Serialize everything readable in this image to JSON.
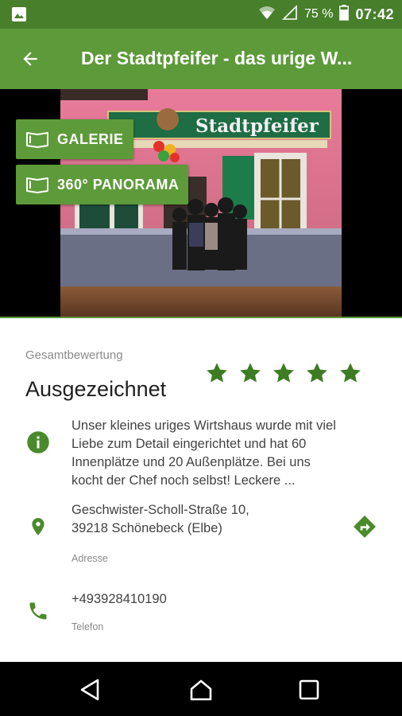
{
  "status_bar": {
    "battery_text": "75 %",
    "time": "07:42",
    "icons": [
      "image-icon",
      "wifi-icon",
      "signal-icon",
      "battery-icon"
    ]
  },
  "app_bar": {
    "title": "Der Stadtpfeifer - das urige W..."
  },
  "hero": {
    "sign_text": "Stadtpfeifer",
    "buttons": {
      "gallery": "GALERIE",
      "panorama": "360° PANORAMA"
    }
  },
  "rating": {
    "label": "Gesamtbewertung",
    "value": "Ausgezeichnet",
    "stars": 5
  },
  "description": {
    "text": "Unser kleines uriges Wirtshaus wurde mit viel Liebe zum Detail eingerichtet und hat 60 Innenplätze und 20 Außenplätze. Bei uns kocht der Chef noch selbst! Leckere ..."
  },
  "address": {
    "line1": "Geschwister-Scholl-Straße 10,",
    "line2": "39218 Schönebeck (Elbe)",
    "label": "Adresse"
  },
  "phone": {
    "number": "+493928410190",
    "label": "Telefon"
  },
  "colors": {
    "primary": "#5d9a3a",
    "primary_dark": "#477f2b",
    "icon_green": "#4a8a2c",
    "star_green": "#3d7c23"
  }
}
